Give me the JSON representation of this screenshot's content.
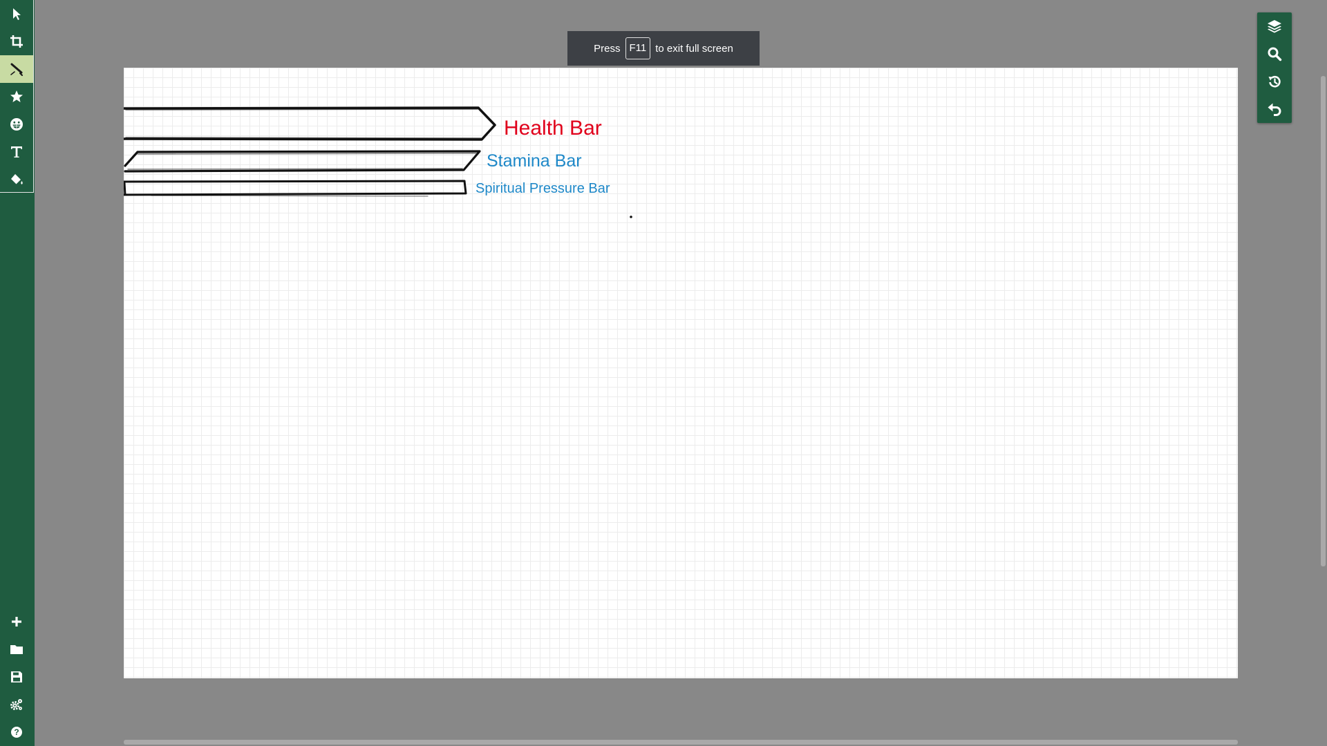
{
  "toolbar_left": {
    "tools": [
      {
        "name": "select",
        "icon": "cursor-arrow-icon",
        "active": false
      },
      {
        "name": "crop",
        "icon": "crop-icon",
        "active": false
      },
      {
        "name": "pen",
        "icon": "pen-icon",
        "active": true
      },
      {
        "name": "shapes",
        "icon": "star-icon",
        "active": false
      },
      {
        "name": "emoji",
        "icon": "grin-icon",
        "active": false
      },
      {
        "name": "text",
        "icon": "text-icon",
        "active": false
      },
      {
        "name": "fill",
        "icon": "paint-bucket-icon",
        "active": false
      }
    ],
    "bottom_tools": [
      {
        "name": "new",
        "icon": "plus-icon"
      },
      {
        "name": "open",
        "icon": "folder-icon"
      },
      {
        "name": "save",
        "icon": "floppy-disk-icon"
      },
      {
        "name": "settings",
        "icon": "gears-icon"
      },
      {
        "name": "help",
        "icon": "question-circle-icon"
      }
    ]
  },
  "toolbar_right": {
    "buttons": [
      {
        "name": "layers",
        "icon": "layers-icon"
      },
      {
        "name": "zoom",
        "icon": "magnifier-icon"
      },
      {
        "name": "history",
        "icon": "history-icon"
      },
      {
        "name": "undo",
        "icon": "undo-icon"
      }
    ]
  },
  "fullscreen_notice": {
    "prefix": "Press",
    "key": "F11",
    "suffix": "to exit full screen"
  },
  "canvas": {
    "labels": {
      "health": "Health Bar",
      "stamina": "Stamina Bar",
      "spiritual": "Spiritual Pressure Bar"
    }
  },
  "colors": {
    "toolbar_bg": "#1f5c40",
    "active_tool_bg": "#c8dba3",
    "health_label": "#e0001b",
    "stamina_label": "#1e88c8",
    "workspace_bg": "#888888",
    "toast_bg": "#3d4045"
  }
}
